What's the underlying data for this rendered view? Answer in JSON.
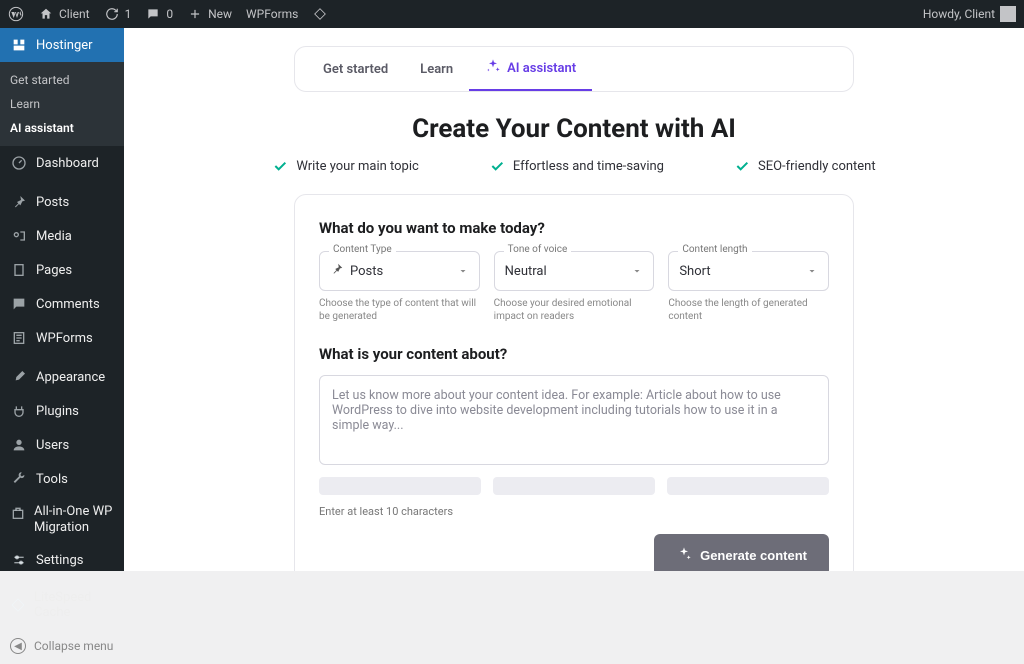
{
  "adminbar": {
    "site_name": "Client",
    "updates_count": "1",
    "comments_count": "0",
    "new_label": "New",
    "wpforms_label": "WPForms",
    "howdy_greeting": "Howdy, Client"
  },
  "sidebar": {
    "items": [
      {
        "icon": "hostinger-icon",
        "label": "Hostinger"
      },
      {
        "icon": "dashboard-icon",
        "label": "Dashboard"
      },
      {
        "icon": "pin-icon",
        "label": "Posts"
      },
      {
        "icon": "media-icon",
        "label": "Media"
      },
      {
        "icon": "page-icon",
        "label": "Pages"
      },
      {
        "icon": "comment-icon",
        "label": "Comments"
      },
      {
        "icon": "document-icon",
        "label": "WPForms"
      },
      {
        "icon": "brush-icon",
        "label": "Appearance"
      },
      {
        "icon": "plug-icon",
        "label": "Plugins"
      },
      {
        "icon": "user-icon",
        "label": "Users"
      },
      {
        "icon": "wrench-icon",
        "label": "Tools"
      },
      {
        "icon": "box-icon",
        "label": "All-in-One WP Migration"
      },
      {
        "icon": "sliders-icon",
        "label": "Settings"
      },
      {
        "icon": "diamond-icon",
        "label": "LiteSpeed Cache"
      }
    ],
    "sub": {
      "get_started": "Get started",
      "learn": "Learn",
      "ai_assistant": "AI assistant"
    },
    "collapse": "Collapse menu"
  },
  "tabs": {
    "get_started": "Get started",
    "learn": "Learn",
    "ai_assistant": "AI assistant"
  },
  "page": {
    "heading": "Create Your Content with AI",
    "checks": [
      "Write your main topic",
      "Effortless and time-saving",
      "SEO-friendly content"
    ],
    "q1": "What do you want to make today?",
    "fields": {
      "content_type": {
        "label": "Content Type",
        "value": "Posts",
        "hint": "Choose the type of content that will be generated"
      },
      "tone": {
        "label": "Tone of voice",
        "value": "Neutral",
        "hint": "Choose your desired emotional impact on readers"
      },
      "length": {
        "label": "Content length",
        "value": "Short",
        "hint": "Choose the length of generated content"
      }
    },
    "q2": "What is your content about?",
    "placeholder": "Let us know more about your content idea. For example: Article about how to use WordPress to dive into website development including tutorials how to use it in a simple way...",
    "counter": "Enter at least 10 characters",
    "generate_btn": "Generate content"
  }
}
